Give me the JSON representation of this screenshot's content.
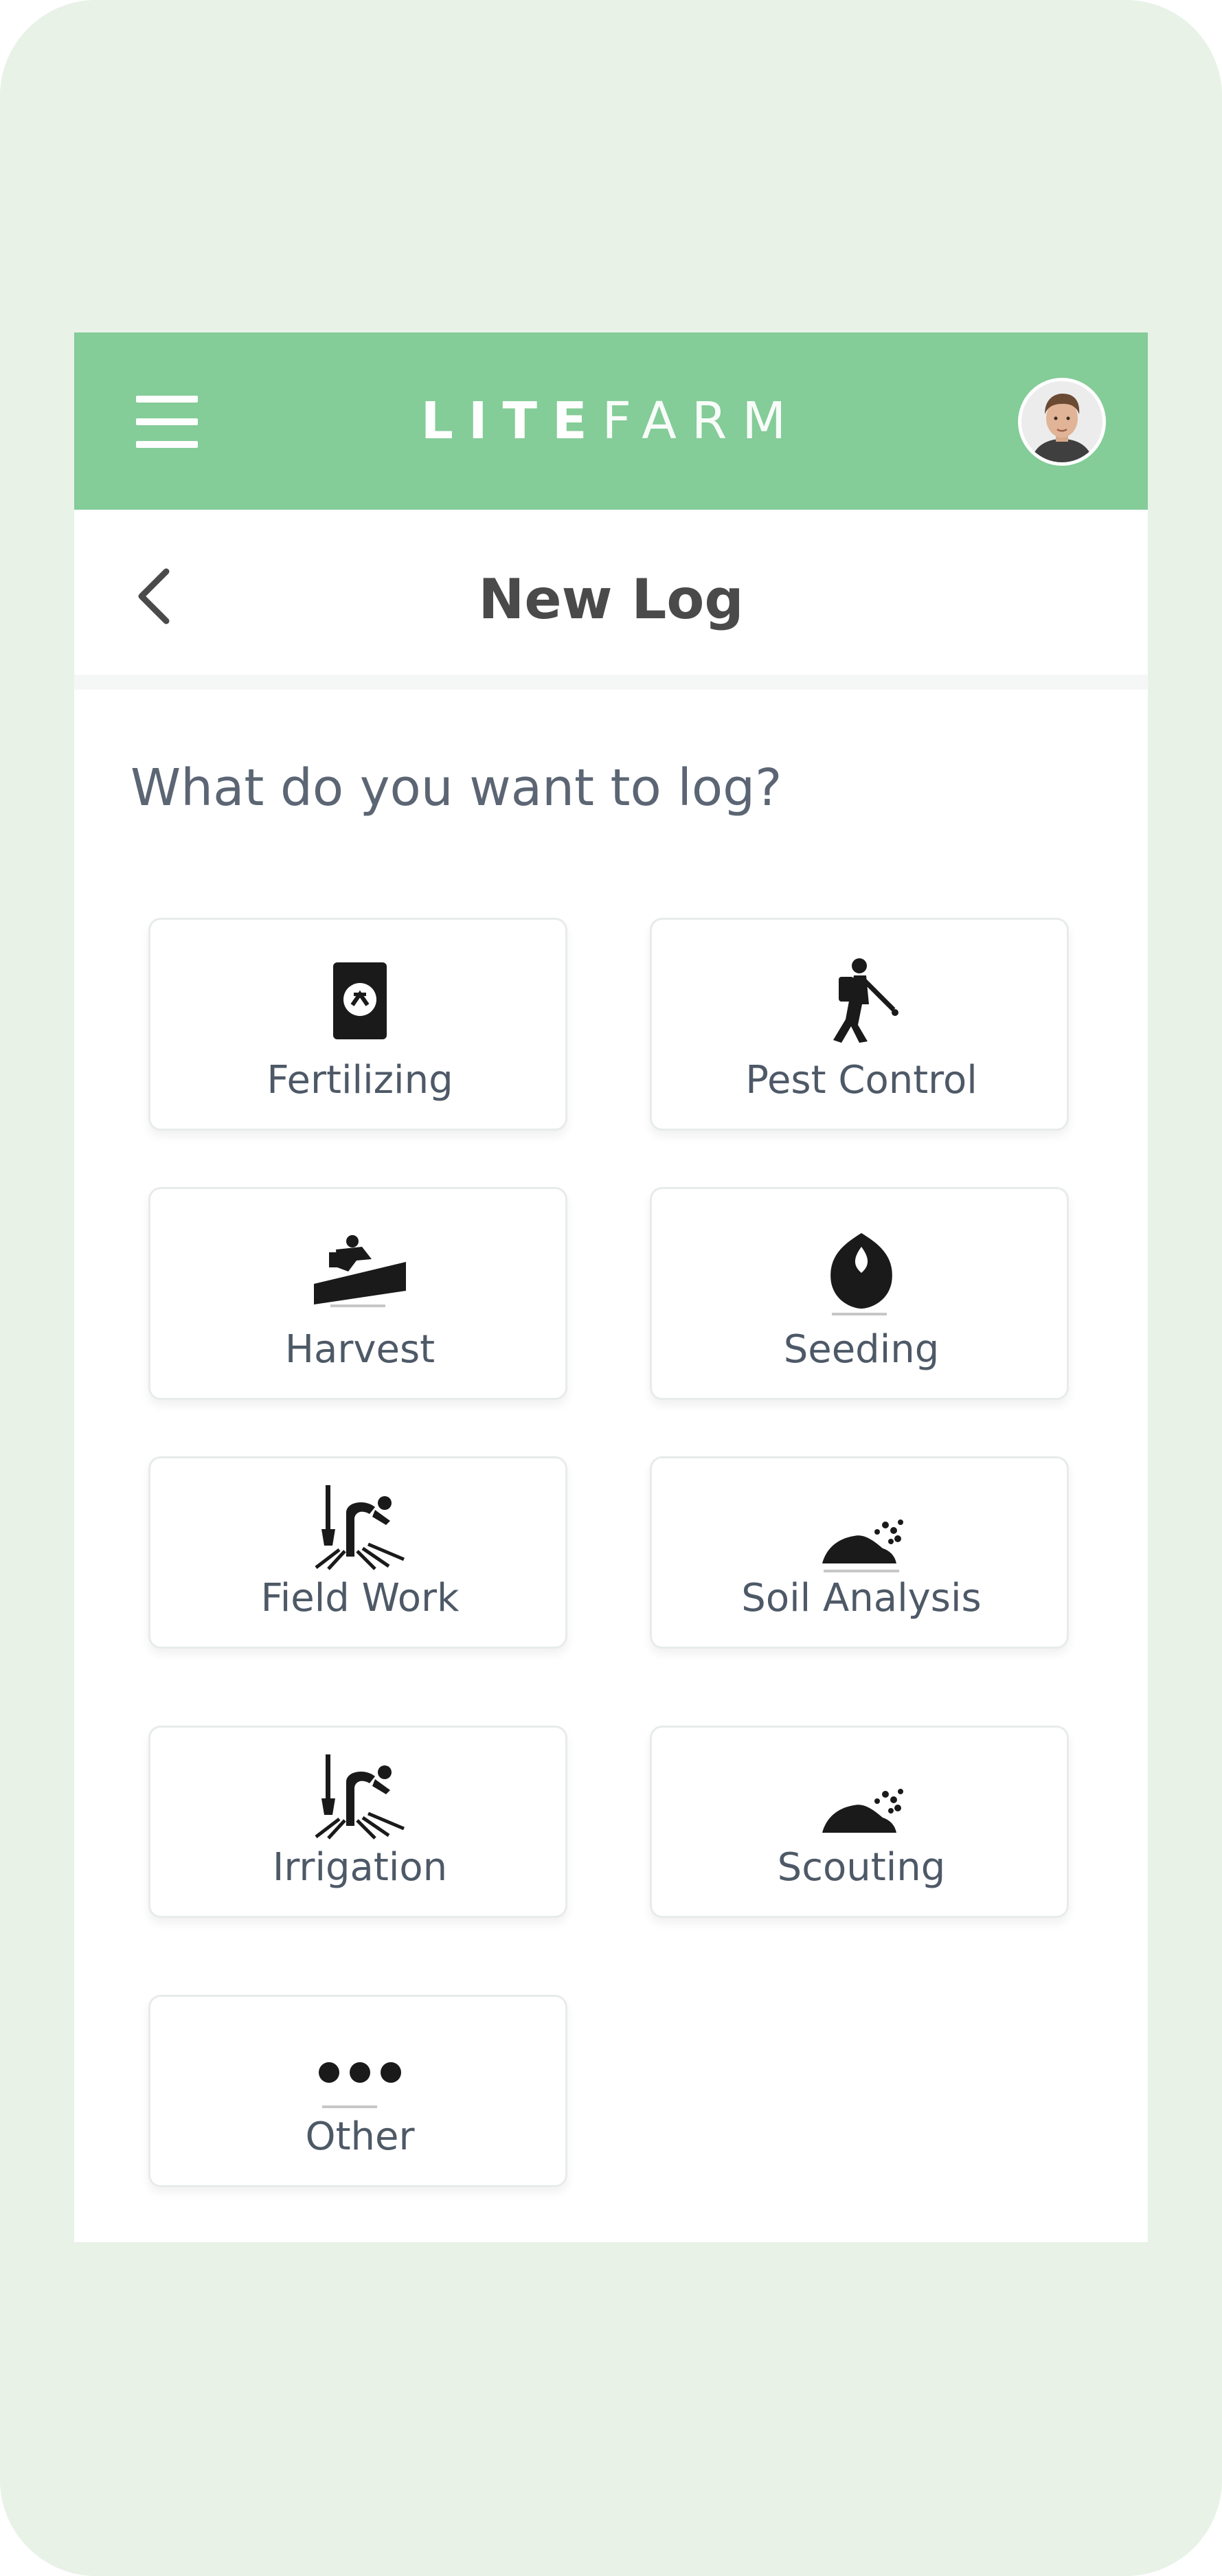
{
  "app": {
    "brand_bold": "LITE",
    "brand_light": "FARM"
  },
  "header": {
    "title": "New Log"
  },
  "prompt": "What do you want to log?",
  "tiles": [
    {
      "label": "Fertilizing",
      "icon": "fertilizer-bag-icon"
    },
    {
      "label": "Pest Control",
      "icon": "pest-sprayer-icon"
    },
    {
      "label": "Harvest",
      "icon": "harvest-icon"
    },
    {
      "label": "Seeding",
      "icon": "seedling-icon"
    },
    {
      "label": "Field Work",
      "icon": "field-work-icon"
    },
    {
      "label": "Soil Analysis",
      "icon": "soil-icon"
    },
    {
      "label": "Irrigation",
      "icon": "irrigation-icon"
    },
    {
      "label": "Scouting",
      "icon": "scouting-icon"
    },
    {
      "label": "Other",
      "icon": "more-dots-icon"
    }
  ],
  "colors": {
    "topbar": "#84cc98",
    "background": "#e8f2e7",
    "text": "#4e5967"
  }
}
